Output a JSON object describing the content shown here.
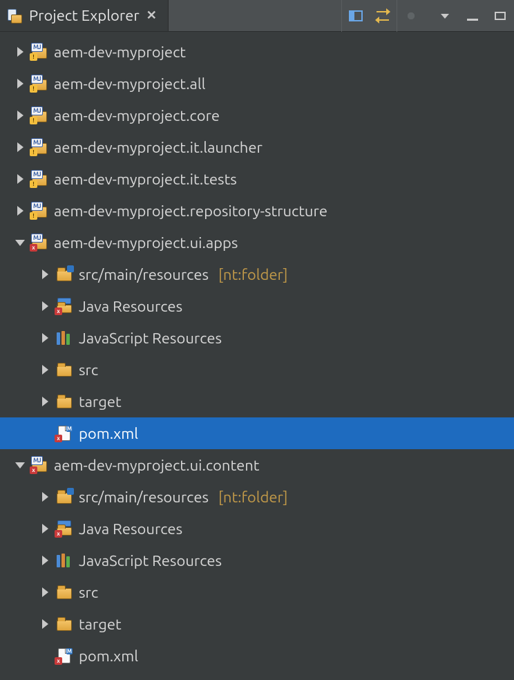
{
  "tab": {
    "title": "Project Explorer"
  },
  "tree": {
    "nodes": [
      {
        "depth": 0,
        "twisty": "closed",
        "icon": "maven-project-warn",
        "label": "aem-dev-myproject"
      },
      {
        "depth": 0,
        "twisty": "closed",
        "icon": "maven-project-warn",
        "label": "aem-dev-myproject.all"
      },
      {
        "depth": 0,
        "twisty": "closed",
        "icon": "maven-project-warn",
        "label": "aem-dev-myproject.core"
      },
      {
        "depth": 0,
        "twisty": "closed",
        "icon": "maven-project-warn",
        "label": "aem-dev-myproject.it.launcher"
      },
      {
        "depth": 0,
        "twisty": "closed",
        "icon": "maven-project-warn",
        "label": "aem-dev-myproject.it.tests"
      },
      {
        "depth": 0,
        "twisty": "closed",
        "icon": "maven-project-warn",
        "label": "aem-dev-myproject.repository-structure"
      },
      {
        "depth": 0,
        "twisty": "open",
        "icon": "maven-project-err",
        "label": "aem-dev-myproject.ui.apps"
      },
      {
        "depth": 1,
        "twisty": "closed",
        "icon": "resource-folder",
        "label": "src/main/resources",
        "decorator": "[nt:folder]"
      },
      {
        "depth": 1,
        "twisty": "closed",
        "icon": "java-resources",
        "label": "Java Resources"
      },
      {
        "depth": 1,
        "twisty": "closed",
        "icon": "js-resources",
        "label": "JavaScript Resources"
      },
      {
        "depth": 1,
        "twisty": "closed",
        "icon": "folder",
        "label": "src"
      },
      {
        "depth": 1,
        "twisty": "closed",
        "icon": "folder",
        "label": "target"
      },
      {
        "depth": 1,
        "twisty": "none",
        "icon": "xml-file-err",
        "label": "pom.xml",
        "selected": true
      },
      {
        "depth": 0,
        "twisty": "open",
        "icon": "maven-project-err",
        "label": "aem-dev-myproject.ui.content"
      },
      {
        "depth": 1,
        "twisty": "closed",
        "icon": "resource-folder",
        "label": "src/main/resources",
        "decorator": "[nt:folder]"
      },
      {
        "depth": 1,
        "twisty": "closed",
        "icon": "java-resources",
        "label": "Java Resources"
      },
      {
        "depth": 1,
        "twisty": "closed",
        "icon": "js-resources",
        "label": "JavaScript Resources"
      },
      {
        "depth": 1,
        "twisty": "closed",
        "icon": "folder",
        "label": "src"
      },
      {
        "depth": 1,
        "twisty": "closed",
        "icon": "folder",
        "label": "target"
      },
      {
        "depth": 1,
        "twisty": "none",
        "icon": "xml-file-err",
        "label": "pom.xml"
      }
    ]
  }
}
